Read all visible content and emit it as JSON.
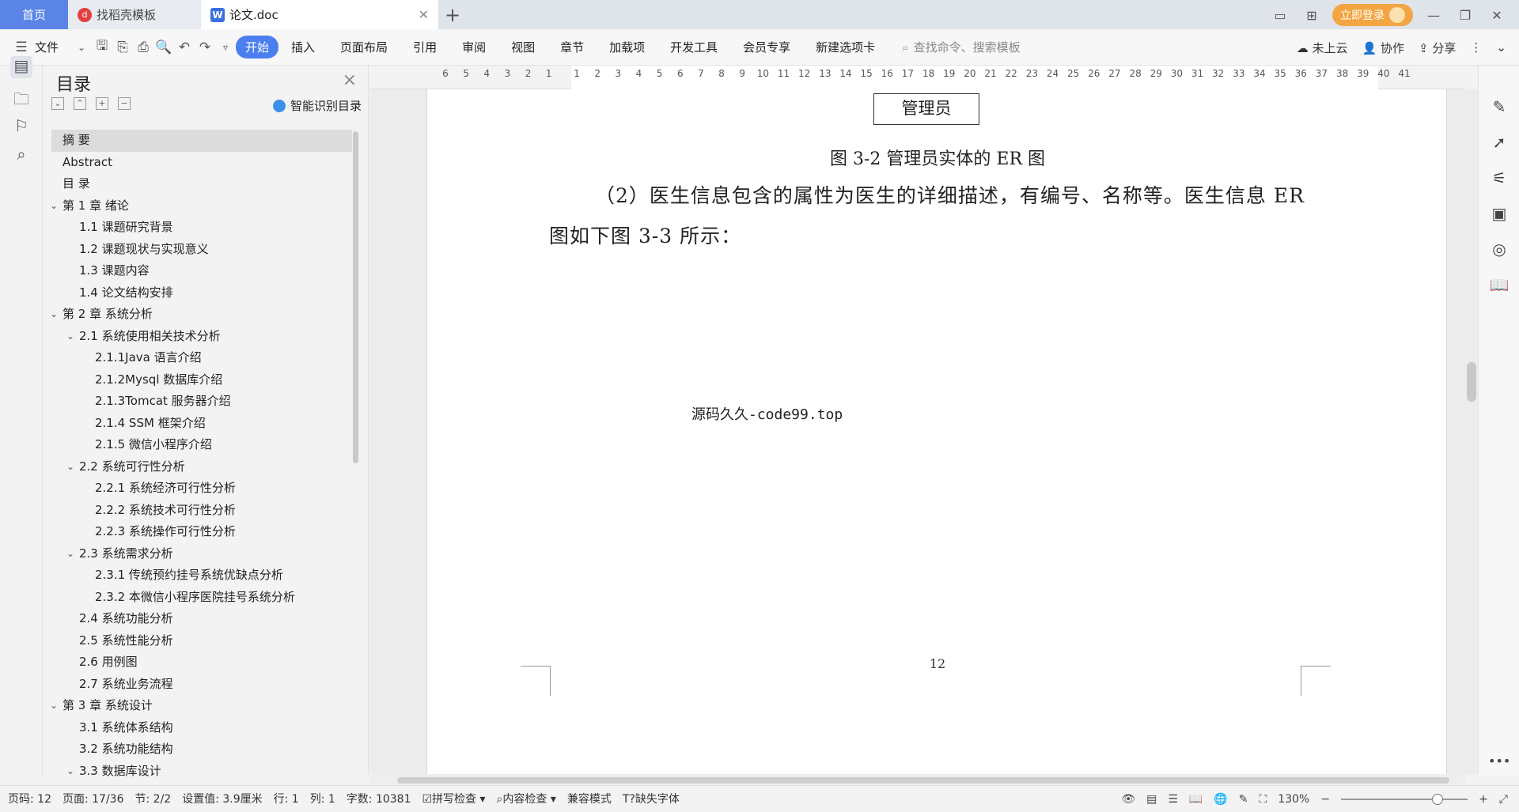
{
  "tabs": {
    "home": "首页",
    "templates": "找稻壳模板",
    "doc": "论文.doc"
  },
  "tabbar_right": {
    "login": "立即登录"
  },
  "toolbar": {
    "file": "文件",
    "menus": [
      "开始",
      "插入",
      "页面布局",
      "引用",
      "审阅",
      "视图",
      "章节",
      "加载项",
      "开发工具",
      "会员专享",
      "新建选项卡"
    ],
    "search_placeholder": "查找命令、搜索模板",
    "cloud": "未上云",
    "collab": "协作",
    "share": "分享"
  },
  "toc": {
    "title": "目录",
    "ai_label": "智能识别目录",
    "items": [
      {
        "label": "摘    要",
        "level": 0,
        "chev": false
      },
      {
        "label": "Abstract",
        "level": 0,
        "chev": false
      },
      {
        "label": "目  录",
        "level": 0,
        "chev": false
      },
      {
        "label": "第 1 章    绪论",
        "level": 0,
        "chev": true
      },
      {
        "label": "1.1 课题研究背景",
        "level": 1,
        "chev": false
      },
      {
        "label": "1.2 课题现状与实现意义",
        "level": 1,
        "chev": false
      },
      {
        "label": "1.3 课题内容",
        "level": 1,
        "chev": false
      },
      {
        "label": "1.4 论文结构安排",
        "level": 1,
        "chev": false
      },
      {
        "label": "第 2 章    系统分析",
        "level": 0,
        "chev": true
      },
      {
        "label": "2.1 系统使用相关技术分析",
        "level": 1,
        "chev": true
      },
      {
        "label": "2.1.1Java 语言介绍",
        "level": 2,
        "chev": false
      },
      {
        "label": "2.1.2Mysql 数据库介绍",
        "level": 2,
        "chev": false
      },
      {
        "label": "2.1.3Tomcat 服务器介绍",
        "level": 2,
        "chev": false
      },
      {
        "label": "2.1.4 SSM 框架介绍",
        "level": 2,
        "chev": false
      },
      {
        "label": "2.1.5 微信小程序介绍",
        "level": 2,
        "chev": false
      },
      {
        "label": "2.2 系统可行性分析",
        "level": 1,
        "chev": true
      },
      {
        "label": "2.2.1 系统经济可行性分析",
        "level": 2,
        "chev": false
      },
      {
        "label": "2.2.2 系统技术可行性分析",
        "level": 2,
        "chev": false
      },
      {
        "label": "2.2.3 系统操作可行性分析",
        "level": 2,
        "chev": false
      },
      {
        "label": "2.3 系统需求分析",
        "level": 1,
        "chev": true
      },
      {
        "label": "2.3.1 传统预约挂号系统优缺点分析",
        "level": 2,
        "chev": false
      },
      {
        "label": "2.3.2 本微信小程序医院挂号系统分析",
        "level": 2,
        "chev": false
      },
      {
        "label": "2.4 系统功能分析",
        "level": 1,
        "chev": false
      },
      {
        "label": "2.5 系统性能分析",
        "level": 1,
        "chev": false
      },
      {
        "label": "2.6 用例图",
        "level": 1,
        "chev": false
      },
      {
        "label": "2.7 系统业务流程",
        "level": 1,
        "chev": false
      },
      {
        "label": "第 3 章    系统设计",
        "level": 0,
        "chev": true
      },
      {
        "label": "3.1 系统体系结构",
        "level": 1,
        "chev": false
      },
      {
        "label": "3.2 系统功能结构",
        "level": 1,
        "chev": false
      },
      {
        "label": "3.3 数据库设计",
        "level": 1,
        "chev": true
      }
    ]
  },
  "ruler": {
    "ticks": [
      "6",
      "5",
      "4",
      "3",
      "2",
      "1",
      "1",
      "2",
      "3",
      "4",
      "5",
      "6",
      "7",
      "8",
      "9",
      "10",
      "11",
      "12",
      "13",
      "14",
      "15",
      "16",
      "17",
      "18",
      "19",
      "20",
      "21",
      "22",
      "23",
      "24",
      "25",
      "26",
      "27",
      "28",
      "29",
      "30",
      "31",
      "32",
      "33",
      "34",
      "35",
      "36",
      "37",
      "38",
      "39",
      "40",
      "41"
    ]
  },
  "document": {
    "er_box": "管理员",
    "caption": "图 3-2 管理员实体的 ER 图",
    "para_line1": "（2）医生信息包含的属性为医生的详细描述，有编号、名称等。医生信息 ER",
    "para_line2": "图如下图 3-3 所示：",
    "watermark": "源码久久-code99.top",
    "page_number": "12"
  },
  "status": {
    "page": "页码: 12",
    "pages": "页面: 17/36",
    "section": "节: 2/2",
    "setting": "设置值: 3.9厘米",
    "row": "行: 1",
    "col": "列: 1",
    "words": "字数: 10381",
    "spell": "拼写检查",
    "content": "内容检查",
    "compat": "兼容模式",
    "font": "缺失字体",
    "zoom": "130%"
  }
}
